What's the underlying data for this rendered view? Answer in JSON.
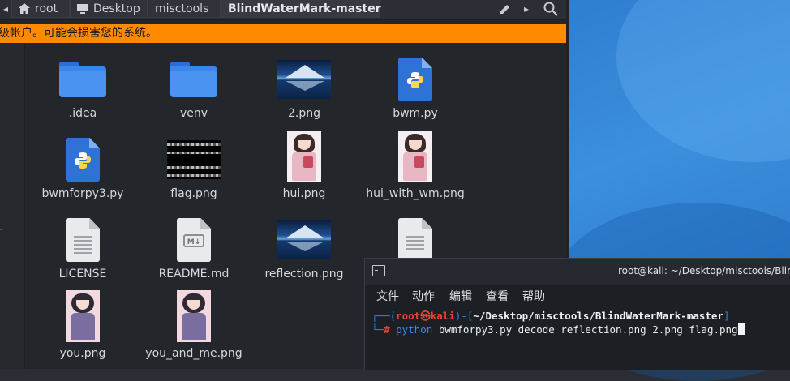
{
  "filemanager": {
    "breadcrumb": [
      {
        "label": "root",
        "icon": "home-icon"
      },
      {
        "label": "Desktop",
        "icon": "desktop-icon"
      },
      {
        "label": "misctools"
      },
      {
        "label": "BlindWaterMark-master",
        "active": true
      }
    ],
    "warning": "级帐户。可能会损害您的系统。",
    "items": [
      {
        "name": ".idea",
        "kind": "folder"
      },
      {
        "name": "venv",
        "kind": "folder"
      },
      {
        "name": "2.png",
        "kind": "landscape"
      },
      {
        "name": "bwm.py",
        "kind": "python"
      },
      {
        "name": "bwmforpy3.py",
        "kind": "python"
      },
      {
        "name": "flag.png",
        "kind": "flag"
      },
      {
        "name": "hui.png",
        "kind": "girl"
      },
      {
        "name": "hui_with_wm.png",
        "kind": "girl"
      },
      {
        "name": "LICENSE",
        "kind": "text"
      },
      {
        "name": "README.md",
        "kind": "markdown"
      },
      {
        "name": "reflection.png",
        "kind": "landscape"
      },
      {
        "name": "you.png",
        "kind": "girl2"
      },
      {
        "name": "you_and_me.png",
        "kind": "girl2"
      }
    ]
  },
  "terminal": {
    "title": "root@kali: ~/Desktop/misctools/Blind",
    "menu": [
      "文件",
      "动作",
      "编辑",
      "查看",
      "帮助"
    ],
    "prompt": {
      "user": "root",
      "at": "㉿",
      "host": "kali",
      "path": "~/Desktop/misctools/BlindWaterMark-master"
    },
    "command": {
      "cmd": "python",
      "args": "bwmforpy3.py decode reflection.png 2.png flag.png"
    }
  },
  "colors": {
    "warning": "#ff8a00",
    "folder": "#3b86ea",
    "prompt": "#2f7de1",
    "user": "#e8413a"
  }
}
